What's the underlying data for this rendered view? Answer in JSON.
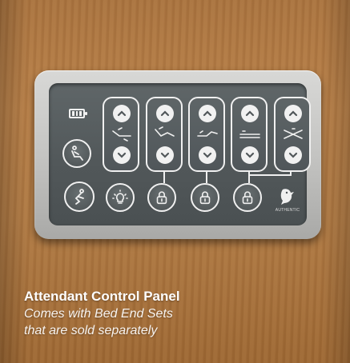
{
  "caption": {
    "title": "Attendant Control Panel",
    "line1": "Comes with Bed End Sets",
    "line2": "that are sold separately"
  },
  "panel": {
    "battery_level": 1.0,
    "left_buttons": [
      {
        "icon": "recline-position-icon"
      },
      {
        "icon": "person-reclining-icon"
      }
    ],
    "rockers": [
      {
        "icon": "backrest-angle-icon"
      },
      {
        "icon": "knee-gatch-icon"
      },
      {
        "icon": "leg-rest-icon"
      },
      {
        "icon": "bed-height-icon"
      },
      {
        "icon": "tilt-position-icon"
      }
    ],
    "bottom_buttons": [
      {
        "icon": "light-bulb-icon"
      },
      {
        "icon": "lock-icon"
      },
      {
        "icon": "lock-icon"
      },
      {
        "icon": "lock-icon"
      }
    ],
    "logo_text": "AUTHENTIC",
    "colors": {
      "housing": "#c4c4c2",
      "face": "#555b5d",
      "symbol": "#f0f0f0"
    }
  }
}
